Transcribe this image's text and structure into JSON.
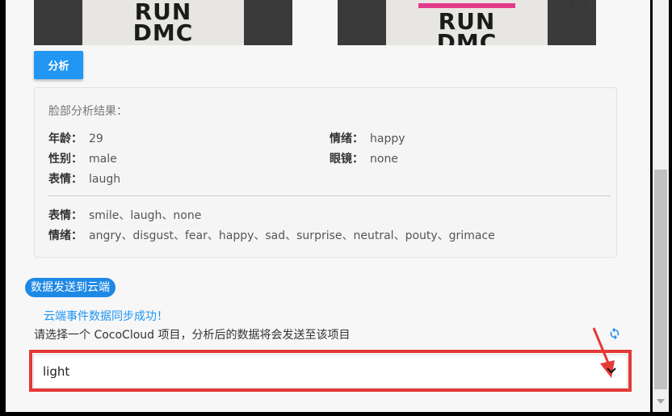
{
  "images": {
    "left_shirt_text": "RUN\nDMC",
    "right_shirt_text": "RUN\nDMC"
  },
  "analyze_button": "分析",
  "result": {
    "title": "脸部分析结果：",
    "age_label": "年龄：",
    "age_value": "29",
    "gender_label": "性别：",
    "gender_value": "male",
    "expression_label": "表情：",
    "expression_value": "laugh",
    "emotion_label": "情绪：",
    "emotion_value": "happy",
    "glasses_label": "眼镜：",
    "glasses_value": "none",
    "expr_options_label": "表情：",
    "expr_options": "smile、laugh、none",
    "emo_options_label": "情绪：",
    "emo_options": "angry、disgust、fear、happy、sad、surprise、neutral、pouty、grimace"
  },
  "cloud": {
    "badge": "数据发送到云端",
    "sync_message": "云端事件数据同步成功！",
    "select_hint": "请选择一个 CocoCloud 项目，分析后的数据将会发送至该项目",
    "selected_project": "light"
  },
  "colors": {
    "accent": "#2196f3",
    "highlight": "#e53935"
  }
}
